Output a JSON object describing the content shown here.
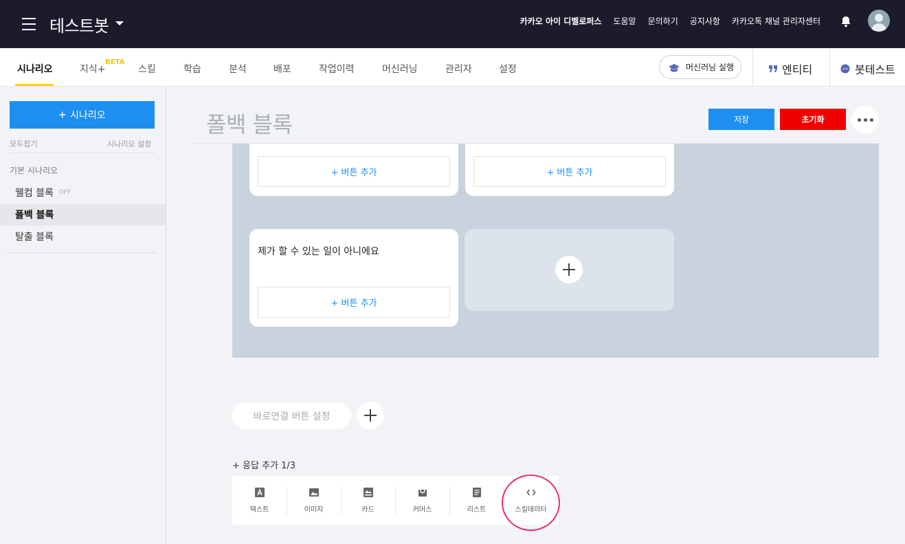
{
  "topbar": {
    "bot_name": "테스트봇",
    "links": [
      "카카오 아이 디벨로퍼스",
      "도움말",
      "문의하기",
      "공지사항",
      "카카오톡 채널 관리자센터"
    ]
  },
  "nav": {
    "tabs": [
      "시나리오",
      "지식+",
      "스킬",
      "학습",
      "분석",
      "배포",
      "작업이력",
      "머신러닝",
      "관리자",
      "설정"
    ],
    "beta_badge": "BETA",
    "ml_run": "머신러닝 실행",
    "entity": "엔티티",
    "bot_test": "봇테스트"
  },
  "sidebar": {
    "add_scenario": "시나리오",
    "collapse_all": "모두접기",
    "scenario_settings": "시나리오 설정",
    "section_title": "기본 시나리오",
    "items": [
      {
        "label": "웰컴 블록",
        "badge": "OFF"
      },
      {
        "label": "폴백 블록",
        "badge": ""
      },
      {
        "label": "탈출 블록",
        "badge": ""
      }
    ]
  },
  "main": {
    "title": "폴백 블록",
    "save": "저장",
    "reset": "초기화",
    "card_text": "제가 할 수 있는 일이 아니에요",
    "add_button": "+ 버튼 추가",
    "quick_reply": "바로연결 버튼 설정",
    "add_response": "+ 응답 추가 1/3",
    "response_types": [
      {
        "label": "텍스트",
        "icon": "text-icon"
      },
      {
        "label": "이미지",
        "icon": "image-icon"
      },
      {
        "label": "카드",
        "icon": "card-icon"
      },
      {
        "label": "커머스",
        "icon": "commerce-icon"
      },
      {
        "label": "리스트",
        "icon": "list-icon"
      },
      {
        "label": "스킬데이터",
        "icon": "skill-data-icon"
      }
    ]
  },
  "colors": {
    "topbar": "#1b1b2c",
    "accent": "#1e8fef",
    "danger": "#f20000",
    "tab_underline": "#ffd400",
    "highlight_ring": "#e8306e"
  }
}
